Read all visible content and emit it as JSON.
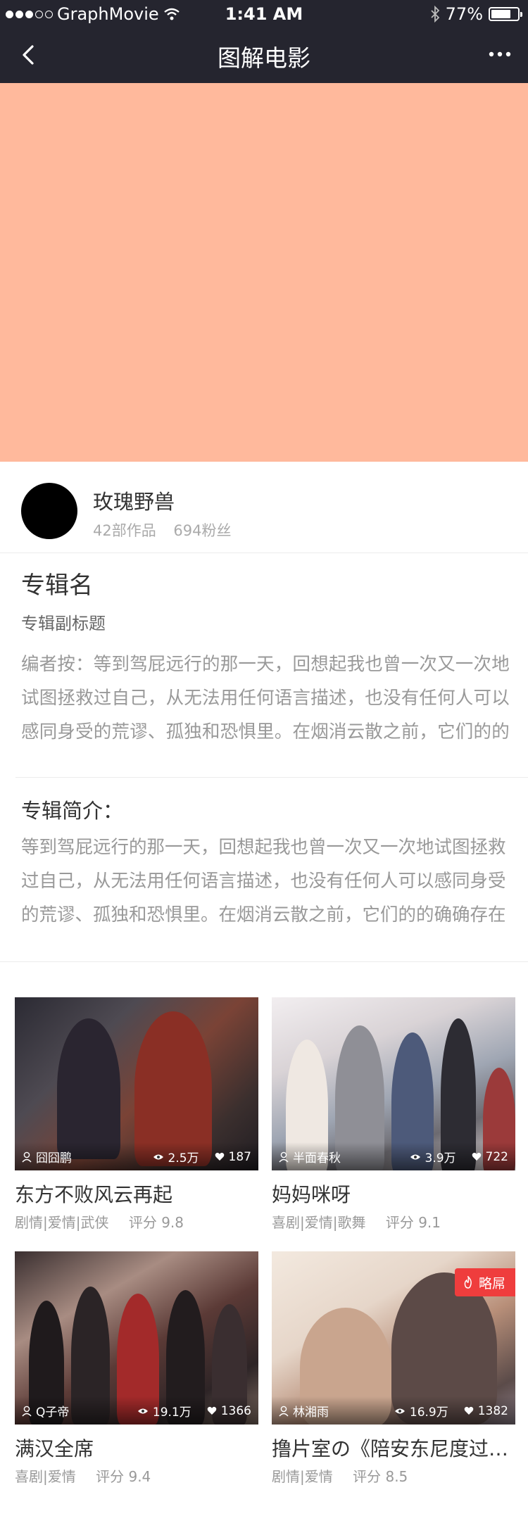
{
  "status_bar": {
    "carrier": "GraphMovie",
    "time": "1:41 AM",
    "battery_percent_label": "77%",
    "battery_level": 0.77
  },
  "nav": {
    "title": "图解电影"
  },
  "author": {
    "name": "玫瑰野兽",
    "works": "42部作品",
    "fans": "694粉丝"
  },
  "album": {
    "name": "专辑名",
    "subtitle": "专辑副标题",
    "editor_note": "编者按：等到驾屁远行的那一天，回想起我也曾一次又一次地试图拯救过自己，从无法用任何语言描述，也没有任何人可以感同身受的荒谬、孤独和恐惧里。在烟消云散之前，它们的的",
    "intro_heading": "专辑简介：",
    "intro_text": "等到驾屁远行的那一天，回想起我也曾一次又一次地试图拯救过自己，从无法用任何语言描述，也没有任何人可以感同身受的荒谬、孤独和恐惧里。在烟消云散之前，它们的的确确存在"
  },
  "cards": [
    {
      "user": "囧囧鹏",
      "views": "2.5万",
      "likes": "187",
      "title": "东方不败风云再起",
      "tags": "剧情|爱情|武侠",
      "score": "评分 9.8"
    },
    {
      "user": "半面春秋",
      "views": "3.9万",
      "likes": "722",
      "title": "妈妈咪呀",
      "tags": "喜剧|爱情|歌舞",
      "score": "评分 9.1"
    },
    {
      "user": "Q子帝",
      "views": "19.1万",
      "likes": "1366",
      "title": "满汉全席",
      "tags": "喜剧|爱情",
      "score": "评分 9.4"
    },
    {
      "user": "林湘雨",
      "views": "16.9万",
      "likes": "1382",
      "title": "撸片室の《陪安东尼度过漫长岁月》",
      "tags": "剧情|爱情",
      "score": "评分 8.5",
      "badge": "略屌"
    }
  ],
  "colors": {
    "nav_bg": "#25252f",
    "cover_bg": "#ffb99c",
    "badge_bg": "#ef3d3d"
  },
  "icons": [
    "wifi-icon",
    "bluetooth-icon",
    "battery-icon",
    "back-icon",
    "more-icon",
    "user-icon",
    "eye-icon",
    "heart-icon",
    "flame-icon"
  ]
}
